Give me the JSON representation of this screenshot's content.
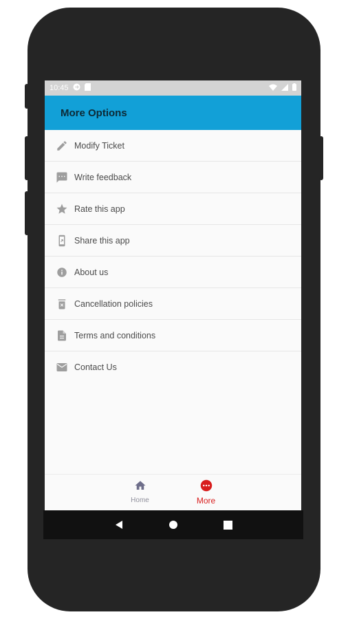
{
  "status_bar": {
    "time": "10:45",
    "icons": [
      "sync-icon",
      "sim-card-icon",
      "wifi-icon",
      "signal-icon",
      "battery-icon"
    ]
  },
  "app_bar": {
    "title": "More Options",
    "color": "#12a0d7"
  },
  "menu": {
    "items": [
      {
        "label": "Modify Ticket",
        "icon": "pencil-icon"
      },
      {
        "label": "Write feedback",
        "icon": "feedback-icon"
      },
      {
        "label": "Rate this app",
        "icon": "star-icon"
      },
      {
        "label": "Share this app",
        "icon": "share-phone-icon"
      },
      {
        "label": "About us",
        "icon": "info-icon"
      },
      {
        "label": "Cancellation policies",
        "icon": "delete-icon"
      },
      {
        "label": "Terms and conditions",
        "icon": "document-icon"
      },
      {
        "label": "Contact Us",
        "icon": "mail-icon"
      }
    ]
  },
  "bottom_nav": {
    "tabs": [
      {
        "label": "Home",
        "icon": "home-icon",
        "active": false
      },
      {
        "label": "More",
        "icon": "more-icon",
        "active": true
      }
    ],
    "active_color": "#d81d1d"
  },
  "system_nav": {
    "buttons": [
      "back-icon",
      "home-circle-icon",
      "recents-icon"
    ]
  }
}
